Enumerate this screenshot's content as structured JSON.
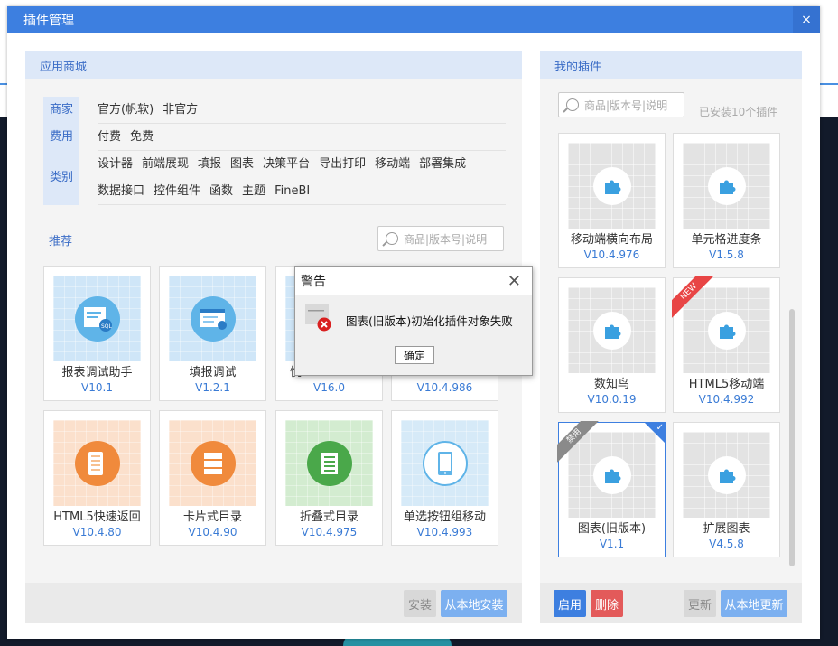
{
  "window": {
    "title": "插件管理",
    "close": "×"
  },
  "store": {
    "header": "应用商城",
    "filters": {
      "vendor": {
        "label": "商家",
        "options": [
          "官方(帆软)",
          "非官方"
        ]
      },
      "fee": {
        "label": "费用",
        "options": [
          "付费",
          "免费"
        ]
      },
      "category": {
        "label": "类别",
        "options": [
          "设计器",
          "前端展现",
          "填报",
          "图表",
          "决策平台",
          "导出打印",
          "移动端",
          "部署集成",
          "数据接口",
          "控件组件",
          "函数",
          "主题",
          "FineBI"
        ]
      }
    },
    "recommend_label": "推荐",
    "search_placeholder": "商品|版本号|说明",
    "cards": [
      {
        "name": "报表调试助手",
        "version": "V10.1",
        "icon": "sql-report-icon",
        "color": "#5fb4e8"
      },
      {
        "name": "填报调试",
        "version": "V1.2.1",
        "icon": "form-debug-icon",
        "color": "#5fb4e8"
      },
      {
        "name": "悦",
        "version": "V16.0",
        "icon": "plugin-icon",
        "color": "#e89c5f"
      },
      {
        "name": "",
        "version": "V10.4.986",
        "icon": "plugin-icon",
        "color": "#5fb4e8"
      },
      {
        "name": "HTML5快速返回",
        "version": "V10.4.80",
        "icon": "mobile-return-icon",
        "color": "#f08a3c"
      },
      {
        "name": "卡片式目录",
        "version": "V10.4.90",
        "icon": "card-catalog-icon",
        "color": "#f08a3c"
      },
      {
        "name": "折叠式目录",
        "version": "V10.4.975",
        "icon": "fold-catalog-icon",
        "color": "#4aa84a"
      },
      {
        "name": "单选按钮组移动",
        "version": "V10.4.993",
        "icon": "radio-mobile-icon",
        "color": "#5fb4e8"
      }
    ],
    "buttons": {
      "install": "安装",
      "install_local": "从本地安装"
    }
  },
  "mine": {
    "header": "我的插件",
    "search_placeholder": "商品|版本号|说明",
    "installed_count": "已安装10个插件",
    "cards": [
      {
        "name": "移动端横向布局",
        "version": "V10.4.976"
      },
      {
        "name": "单元格进度条",
        "version": "V1.5.8"
      },
      {
        "name": "数知鸟",
        "version": "V10.0.19"
      },
      {
        "name": "HTML5移动端",
        "version": "V10.4.992",
        "badge": "NEW"
      },
      {
        "name": "图表(旧版本)",
        "version": "V1.1",
        "badge": "禁用",
        "selected": true
      },
      {
        "name": "扩展图表",
        "version": "V4.5.8"
      }
    ],
    "buttons": {
      "enable": "启用",
      "delete": "删除",
      "update": "更新",
      "update_local": "从本地更新"
    }
  },
  "alert": {
    "title": "警告",
    "message": "图表(旧版本)初始化插件对象失败",
    "ok": "确定"
  },
  "colors": {
    "primary": "#3d7fe0",
    "danger": "#e35a5a",
    "light_button": "#7cb0f0",
    "disabled_button": "#d8d8d8"
  }
}
